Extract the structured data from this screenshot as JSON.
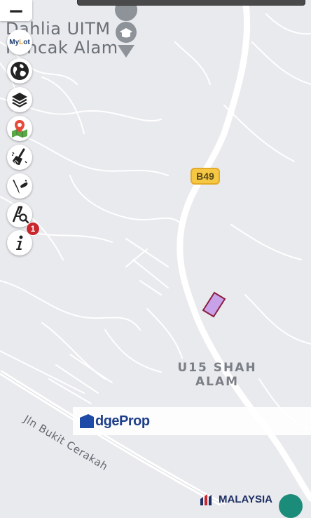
{
  "map": {
    "poi_title": "Dahlia UITM Puncak Alam",
    "poi_title_line1": "Dahlia UITM",
    "poi_title_line2": "Puncak Alam",
    "area_label_line1": "U15 SHAH",
    "area_label_line2": "ALAM",
    "street_label": "Jln Bukit Cerakah",
    "route_badge": "B49",
    "colors": {
      "background": "#e9eaee",
      "road": "#ffffff",
      "highlighted_lot_fill": "#c8a2e8",
      "highlighted_lot_border": "#8b1e3f",
      "route_badge": "#f5c742"
    }
  },
  "controls": {
    "zoom_out_label": "−",
    "tools": [
      {
        "name": "mylot-logo",
        "label": "MyLot"
      },
      {
        "name": "globe-icon"
      },
      {
        "name": "layers-icon"
      },
      {
        "name": "map-pin-icon"
      },
      {
        "name": "broom-icon"
      },
      {
        "name": "malaysia-map-icon"
      },
      {
        "name": "text-search-icon"
      },
      {
        "name": "info-icon"
      }
    ],
    "notification_count": "1"
  },
  "branding": {
    "edgeprop": "EdgeProp",
    "edgeprop_prefix": "E",
    "edgeprop_suffix": "dgeProp",
    "malaysia": "MALAYSIA"
  }
}
